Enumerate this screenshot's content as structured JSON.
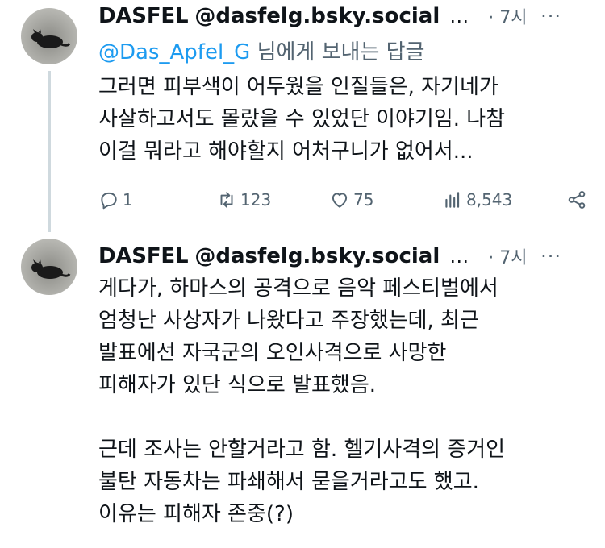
{
  "tweets": [
    {
      "name": "DASFEL",
      "handle": "@dasfelg.bsky.social",
      "ellipsis": "…",
      "time": "· 7시",
      "more": "···",
      "reply_to_mention": "@Das_Apfel_G",
      "reply_to_suffix": " 님에게 보내는 답글",
      "lines": [
        "그러면 피부색이 어두웠을 인질들은, 자기네가",
        "사살하고서도 몰랐을 수 있었단 이야기임. 나참",
        "이걸 뭐라고 해야할지 어처구니가 없어서..."
      ],
      "actions": {
        "replies": "1",
        "reposts": "123",
        "likes": "75",
        "views": "8,543"
      }
    },
    {
      "name": "DASFEL",
      "handle": "@dasfelg.bsky.social",
      "ellipsis": "…",
      "time": "· 7시",
      "more": "···",
      "lines": [
        "게다가, 하마스의 공격으로 음악 페스티벌에서",
        "엄청난 사상자가 나왔다고 주장했는데, 최근",
        "발표에선 자국군의 오인사격으로 사망한",
        "피해자가 있단 식으로 발표했음.",
        "",
        "근데 조사는 안할거라고 함. 헬기사격의 증거인",
        "불탄 자동차는 파쇄해서 묻을거라고도 했고.",
        "이유는 피해자 존중(?)"
      ]
    }
  ],
  "colors": {
    "text": "#0f1419",
    "secondary": "#536471",
    "link": "#1d9bf0",
    "thread_line": "#cfd9de"
  },
  "icons": [
    "reply-icon",
    "repost-icon",
    "like-icon",
    "views-icon",
    "share-icon"
  ]
}
